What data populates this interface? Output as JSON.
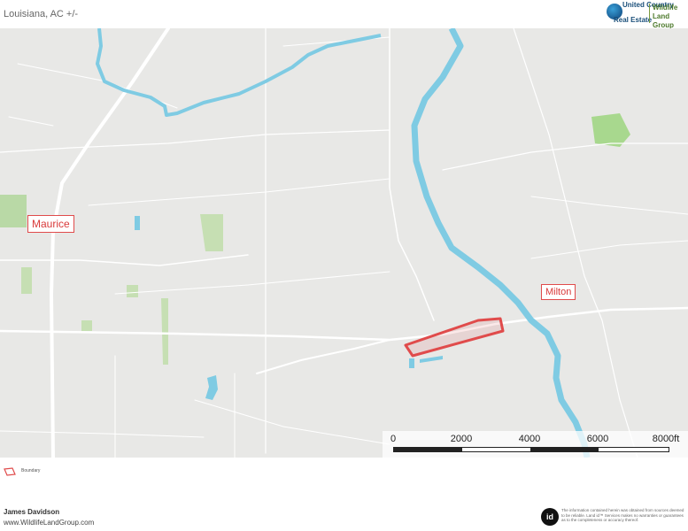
{
  "header": {
    "title": "Louisiana,  AC +/-",
    "brand_line1": "United Country",
    "brand_line2": "Real Estate",
    "brand_line3": "Wildlife",
    "brand_line4": "Land Group"
  },
  "map": {
    "towns": [
      {
        "name": "Maurice"
      },
      {
        "name": "Milton"
      }
    ],
    "colors": {
      "background": "#e8e8e6",
      "roads": "#ffffff",
      "water": "#7fcbe3",
      "parks": "#b9d9a6",
      "boundary": "#e04b4b"
    },
    "scale": {
      "ticks": [
        "0",
        "2000",
        "4000",
        "6000",
        "8000ft"
      ]
    }
  },
  "legend": {
    "items": [
      {
        "label": "Boundary",
        "icon": "boundary-polygon-icon"
      }
    ]
  },
  "footer": {
    "agent": "James Davidson",
    "url": "www.WildlifeLandGroup.com",
    "logo_text": "id",
    "disclaimer": "The information contained herein was obtained from sources deemed to be reliable. Land id™ Services makes no warranties or guarantees as to the completeness or accuracy thereof."
  }
}
